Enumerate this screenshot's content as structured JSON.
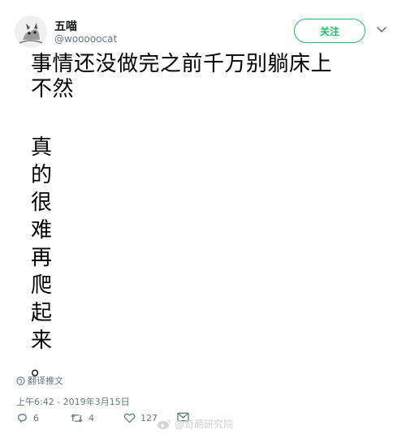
{
  "author": {
    "display_name": "五喵",
    "handle": "@wooooocat",
    "avatar_icon": "cat-sketch-avatar"
  },
  "follow_label": "关注",
  "tweet": {
    "lines": [
      "事情还没做完之前千万别躺床上",
      "不然"
    ],
    "vertical_chars": [
      "真",
      "的",
      "很",
      "难",
      "再",
      "爬",
      "起",
      "来",
      "。"
    ]
  },
  "translate_label": "翻译推文",
  "timestamp": "上午6:42 - 2019年3月15日",
  "actions": {
    "reply_count": "6",
    "retweet_count": "4",
    "like_count": "127"
  },
  "watermark_text": "@奇葩研究院",
  "colors": {
    "accent": "#17bf63",
    "muted": "#657786"
  }
}
